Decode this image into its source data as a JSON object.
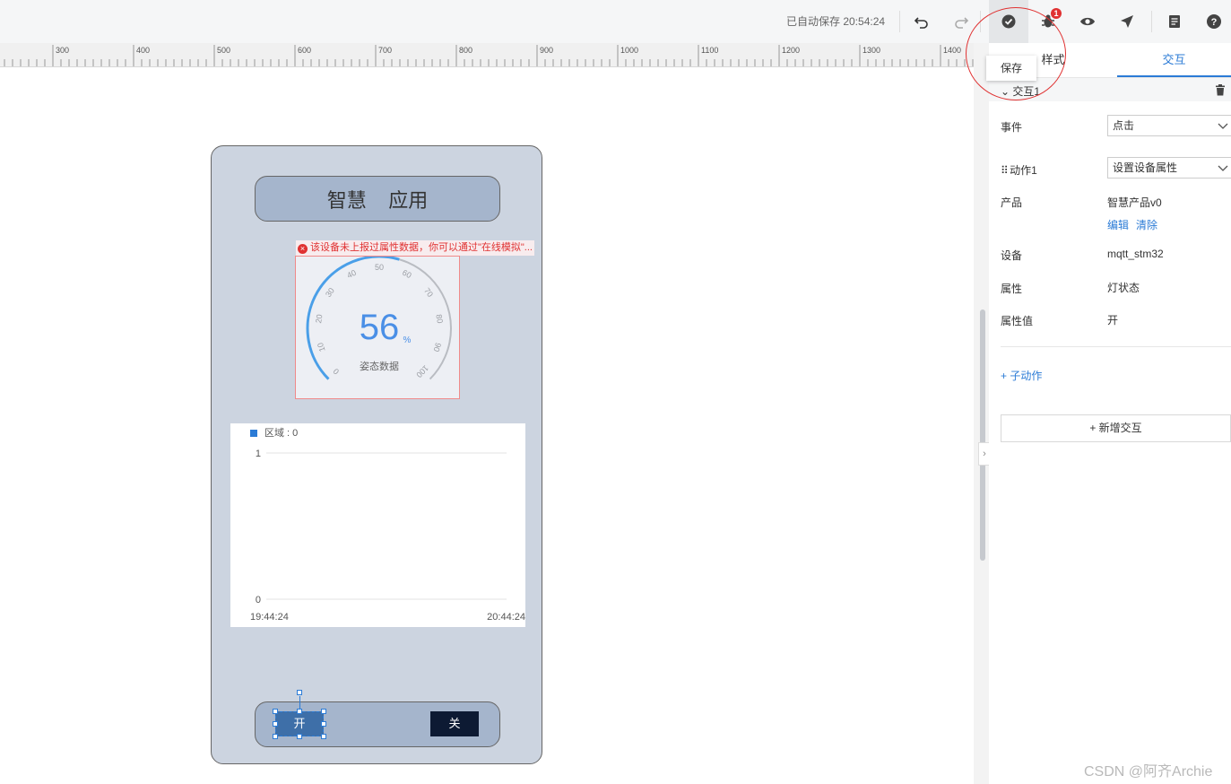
{
  "toolbar": {
    "autosave_text": "已自动保存 20:54:24",
    "icons": [
      "undo-icon",
      "redo-icon",
      "save-check-icon",
      "bug-icon",
      "preview-eye-icon",
      "publish-send-icon",
      "doc-icon",
      "help-icon"
    ],
    "debug_badge": "1",
    "tooltip": "保存"
  },
  "ruler": {
    "labels": [
      "300",
      "400",
      "500",
      "600",
      "700",
      "800",
      "900",
      "1000",
      "1100",
      "1200",
      "1300",
      "1400"
    ]
  },
  "phone": {
    "title": "智慧    应用",
    "warning": "该设备未上报过属性数据，你可以通过\"在线模拟\"...",
    "gauge": {
      "value": "56",
      "unit": "%",
      "label": "姿态数据",
      "ticks": [
        "0",
        "10",
        "20",
        "30",
        "40",
        "50",
        "60",
        "70",
        "80",
        "90",
        "100"
      ]
    },
    "btn_on": "开",
    "btn_off": "关"
  },
  "chart_data": {
    "type": "line",
    "legend": "区域 : 0",
    "y_ticks": [
      "1",
      "0"
    ],
    "x_ticks": [
      "19:44:24",
      "20:44:24"
    ],
    "ylim": [
      0,
      1
    ],
    "series": []
  },
  "panel": {
    "tabs": [
      "样式",
      "交互"
    ],
    "active_tab": "交互",
    "group_title": "交互1",
    "event_label": "事件",
    "event_value": "点击",
    "action_label": "动作1",
    "action_value": "设置设备属性",
    "product_label": "产品",
    "product_value": "智慧产品v0",
    "edit_link": "编辑",
    "clear_link": "清除",
    "device_label": "设备",
    "device_value": "mqtt_stm32",
    "attr_label": "属性",
    "attr_value": "灯状态",
    "attr_val_label": "属性值",
    "attr_val_value": "开",
    "add_sub_action": "+ 子动作",
    "add_interaction": "+ 新增交互"
  },
  "watermark": "CSDN @阿齐Archie",
  "colors": {
    "accent": "#2b7bd6",
    "error": "#e03131",
    "button_on": "#3e6fa8",
    "button_off": "#0d1a33",
    "phone_bg": "#ccd4e0"
  }
}
